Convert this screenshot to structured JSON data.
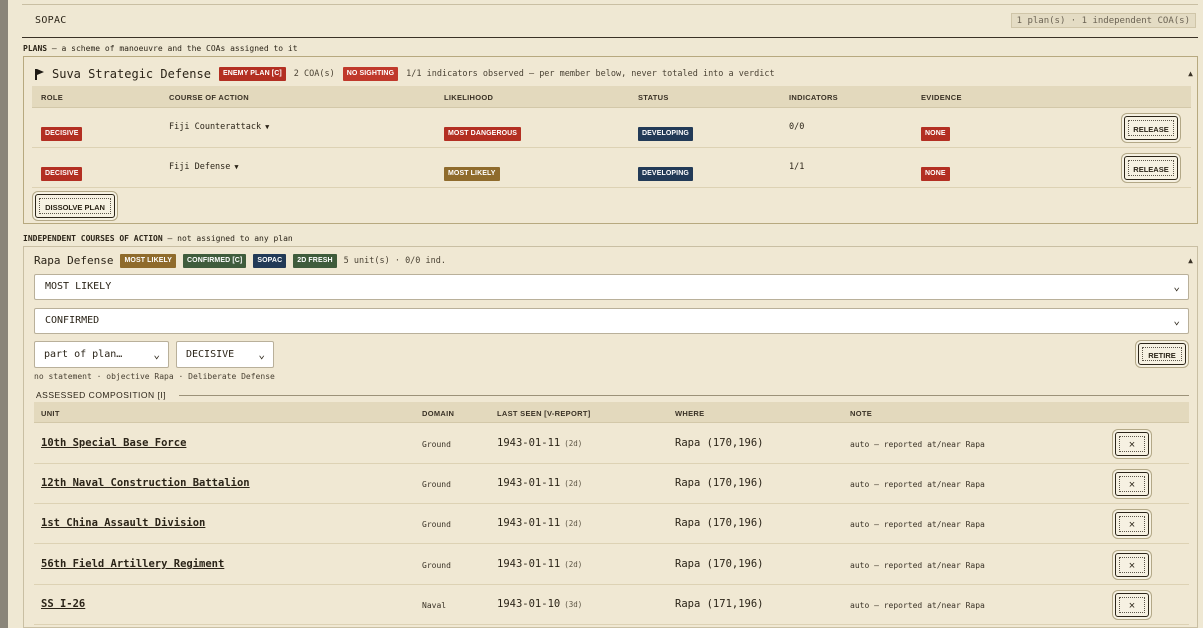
{
  "theatre": {
    "title": "SOPAC",
    "summary": "1 plan(s) · 1 independent COA(s)"
  },
  "plans_label": {
    "head": "PLANS",
    "desc": " — a scheme of manoeuvre and the COAs assigned to it"
  },
  "plan": {
    "name": "Suva Strategic Defense",
    "enemy_badge": "ENEMY PLAN [C]",
    "coa_count": "2 COA(s)",
    "sighting_badge": "NO SIGHTING",
    "indicators_text": "1/1 indicators observed — per member below, never totaled into a verdict",
    "collapse": "▲",
    "columns": [
      "ROLE",
      "COURSE OF ACTION",
      "LIKELIHOOD",
      "STATUS",
      "INDICATORS",
      "EVIDENCE"
    ],
    "rows": [
      {
        "role": "DECISIVE",
        "coa": "Fiji Counterattack",
        "caret": "▼",
        "likelihood": "MOST DANGEROUS",
        "likelihood_color": "#b32f22",
        "status": "DEVELOPING",
        "indicators": "0/0",
        "evidence": "NONE",
        "action": "RELEASE"
      },
      {
        "role": "DECISIVE",
        "coa": "Fiji Defense",
        "caret": "▼",
        "likelihood": "MOST LIKELY",
        "likelihood_color": "#8f6b2c",
        "status": "DEVELOPING",
        "indicators": "1/1",
        "evidence": "NONE",
        "action": "RELEASE"
      }
    ],
    "dissolve_label": "DISSOLVE PLAN"
  },
  "indep_label": {
    "head": "INDEPENDENT COURSES OF ACTION",
    "desc": " — not assigned to any plan"
  },
  "coa": {
    "name": "Rapa Defense",
    "badges": [
      "MOST LIKELY",
      "CONFIRMED [C]",
      "SOPAC",
      "2D FRESH"
    ],
    "badge_colors": [
      "#8f6b2c",
      "#3f5c3c",
      "#223a57",
      "#3f5c3c"
    ],
    "meta": "5 unit(s) · 0/0 ind.",
    "collapse": "▲",
    "likelihood_select": "MOST LIKELY",
    "confidence_select": "CONFIRMED",
    "plan_select": "part of plan…",
    "role_select": "DECISIVE",
    "retire_label": "RETIRE",
    "statement": "no statement · objective Rapa · Deliberate Defense",
    "composition_title": "ASSESSED COMPOSITION [I]",
    "unit_columns": [
      "UNIT",
      "DOMAIN",
      "LAST SEEN [V-REPORT]",
      "WHERE",
      "NOTE"
    ],
    "units": [
      {
        "name": "10th Special Base Force",
        "domain": "Ground",
        "seen": "1943-01-11",
        "age": "(2d)",
        "where": "Rapa (170,196)",
        "note": "auto — reported at/near Rapa",
        "remove": "×"
      },
      {
        "name": "12th Naval Construction Battalion",
        "domain": "Ground",
        "seen": "1943-01-11",
        "age": "(2d)",
        "where": "Rapa (170,196)",
        "note": "auto — reported at/near Rapa",
        "remove": "×"
      },
      {
        "name": "1st China Assault Division",
        "domain": "Ground",
        "seen": "1943-01-11",
        "age": "(2d)",
        "where": "Rapa (170,196)",
        "note": "auto — reported at/near Rapa",
        "remove": "×"
      },
      {
        "name": "56th Field Artillery Regiment",
        "domain": "Ground",
        "seen": "1943-01-11",
        "age": "(2d)",
        "where": "Rapa (170,196)",
        "note": "auto — reported at/near Rapa",
        "remove": "×"
      },
      {
        "name": "SS I-26",
        "domain": "Naval",
        "seen": "1943-01-10",
        "age": "(3d)",
        "where": "Rapa (171,196)",
        "note": "auto — reported at/near Rapa",
        "remove": "×"
      }
    ]
  },
  "colors": {
    "background": "#efe8d3",
    "red": "#b32f22",
    "navy": "#223a57",
    "brown": "#8f6b2c",
    "green": "#3f5c3c"
  }
}
